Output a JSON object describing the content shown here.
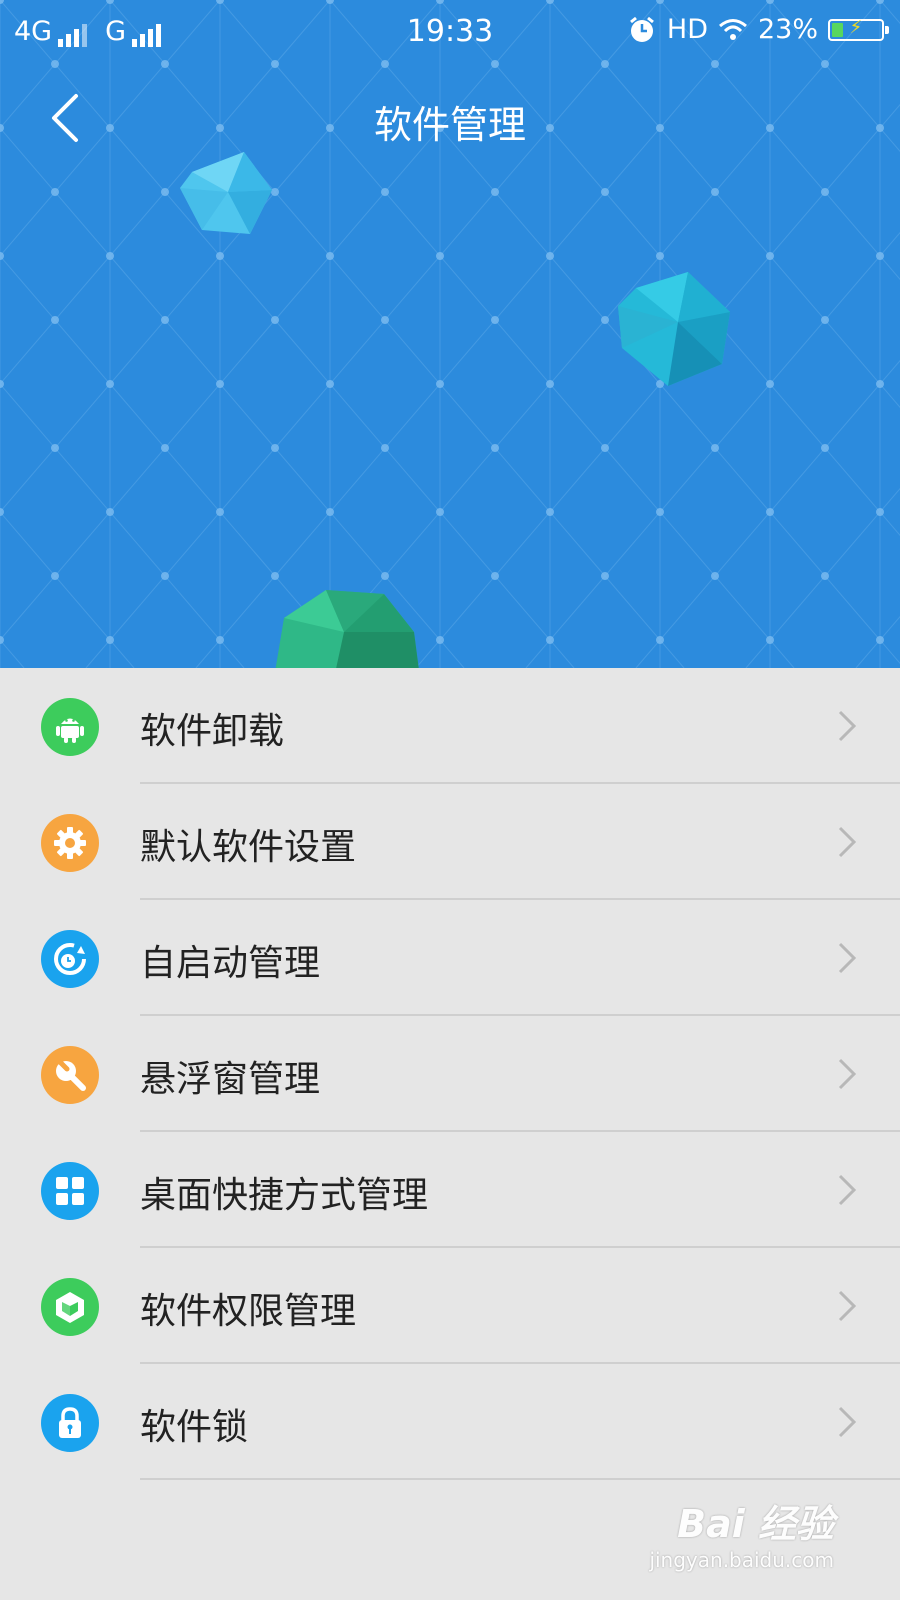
{
  "status_bar": {
    "network_1": "4G",
    "network_2": "G",
    "time": "19:33",
    "hd": "HD",
    "battery_percent": "23%",
    "battery_level": 0.23,
    "icons": [
      "signal-icon",
      "alarm-icon",
      "wifi-icon",
      "battery-charging-icon"
    ]
  },
  "header": {
    "title": "软件管理",
    "back_icon": "chevron-left-icon",
    "background_color": "#2c8bdd"
  },
  "menu": {
    "items": [
      {
        "label": "软件卸载",
        "icon": "android-icon",
        "color": "#3dcc5c"
      },
      {
        "label": "默认软件设置",
        "icon": "gear-icon",
        "color": "#f7a540"
      },
      {
        "label": "自启动管理",
        "icon": "autostart-icon",
        "color": "#1aa3ee"
      },
      {
        "label": "悬浮窗管理",
        "icon": "wrench-icon",
        "color": "#f7a540"
      },
      {
        "label": "桌面快捷方式管理",
        "icon": "grid-icon",
        "color": "#1aa3ee"
      },
      {
        "label": "软件权限管理",
        "icon": "shield-cube-icon",
        "color": "#3dcc5c"
      },
      {
        "label": "软件锁",
        "icon": "lock-icon",
        "color": "#1aa3ee"
      }
    ],
    "chevron_icon": "chevron-right-icon"
  },
  "watermark": {
    "brand": "Bai 经验",
    "url": "jingyan.baidu.com"
  }
}
